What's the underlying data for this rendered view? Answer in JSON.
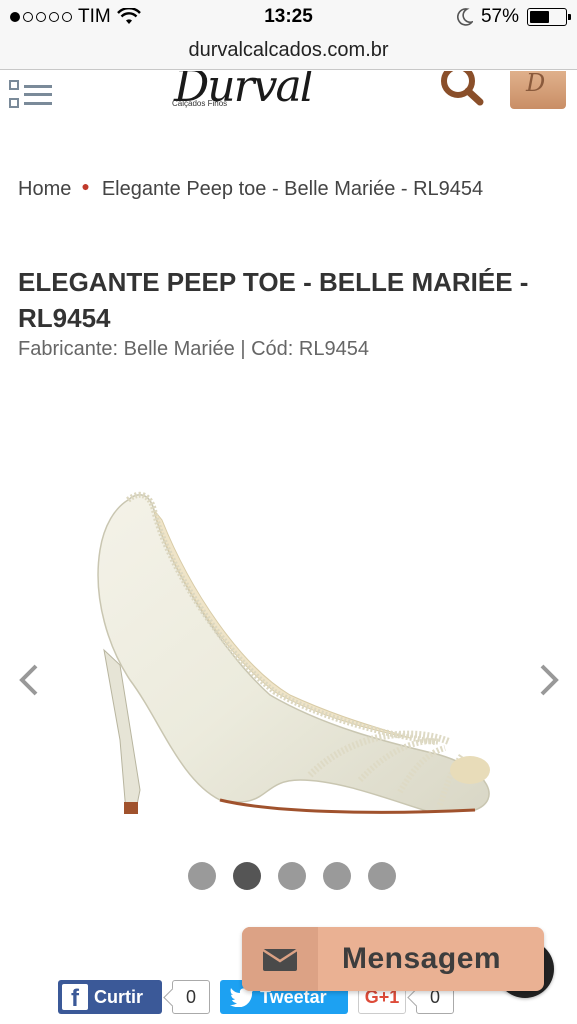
{
  "status_bar": {
    "carrier": "TIM",
    "time": "13:25",
    "battery": "57%",
    "battery_level": 0.57,
    "signal_bars": 1,
    "signal_total": 5
  },
  "browser": {
    "url": "durvalcalcados.com.br"
  },
  "header": {
    "logo_text": "Durval",
    "logo_tagline": "Calçados Finos",
    "logo_badge": "D",
    "menu_icon": "menu-icon",
    "search_icon": "search-icon",
    "cart_icon": "cart-icon"
  },
  "breadcrumb": {
    "home": "Home",
    "current": "Elegante Peep toe - Belle Mariée - RL9454"
  },
  "product": {
    "title": "ELEGANTE PEEP TOE - BELLE MARIÉE - RL9454",
    "meta": "Fabricante: Belle Mariée | Cód: RL9454",
    "gallery_count": 5,
    "gallery_active_index": 2
  },
  "share": {
    "facebook_label": "Curtir",
    "facebook_count": "0",
    "twitter_label": "Tweetar",
    "googleplus_label": "G+1",
    "googleplus_count": "0"
  },
  "message_widget": {
    "label": "Mensagem",
    "icon": "envelope-icon"
  },
  "colors": {
    "accent_red": "#c0392b",
    "message_bg": "#eab193",
    "facebook": "#3b5998",
    "twitter": "#1da1f2"
  }
}
